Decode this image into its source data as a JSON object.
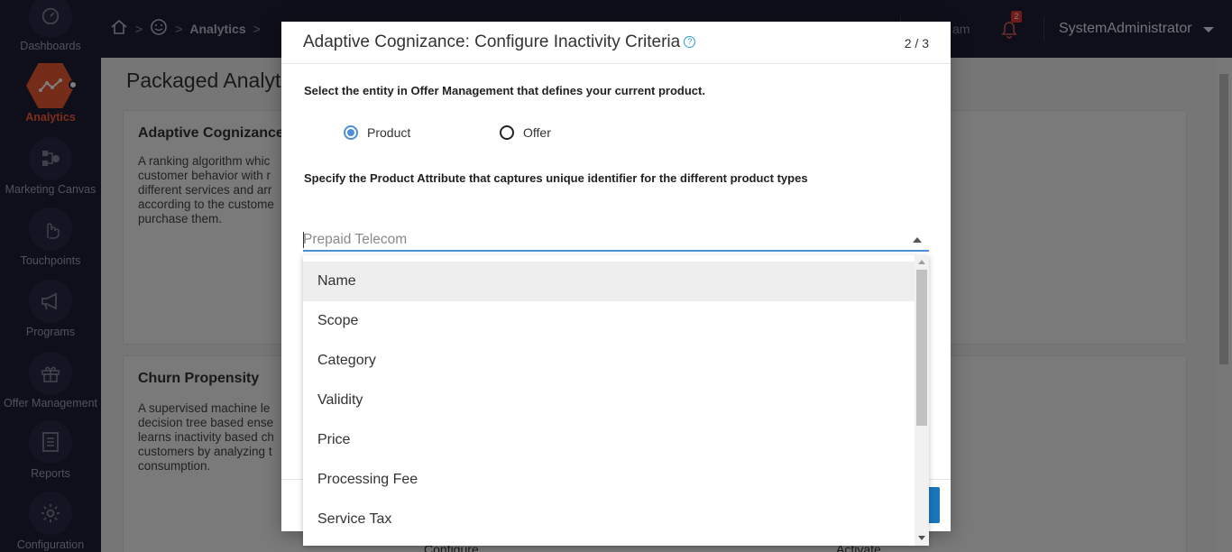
{
  "sidebar": {
    "items": [
      {
        "label": "Dashboards",
        "icon": "dashboard-icon",
        "active": false
      },
      {
        "label": "Analytics",
        "icon": "analytics-icon",
        "active": true
      },
      {
        "label": "Marketing Canvas",
        "icon": "canvas-icon",
        "active": false
      },
      {
        "label": "Touchpoints",
        "icon": "touch-icon",
        "active": false
      },
      {
        "label": "Programs",
        "icon": "megaphone-icon",
        "active": false
      },
      {
        "label": "Offer Management",
        "icon": "gift-icon",
        "active": false
      },
      {
        "label": "Reports",
        "icon": "report-icon",
        "active": false
      },
      {
        "label": "Configuration",
        "icon": "gear-icon",
        "active": false
      }
    ],
    "accent_color": "#ea5a34"
  },
  "topbar": {
    "breadcrumb": [
      "Analytics"
    ],
    "team_text": "am",
    "notification_count": "2",
    "user_name": "SystemAdministrator"
  },
  "page": {
    "title": "Packaged Analyti",
    "cards": [
      {
        "title": "Adaptive Cognizance",
        "desc": "A ranking algorithm whic customer behavior with r different services and arr according to the custome purchase them."
      },
      {
        "title": "Churn Propensity",
        "desc": "A supervised machine le decision tree based ense learns inactivity based ch customers by analyzing t consumption."
      }
    ],
    "card_links": {
      "configure": "Configure",
      "activate": "Activate"
    }
  },
  "modal": {
    "title": "Adaptive Cognizance: Configure Inactivity Criteria",
    "help_glyph": "?",
    "step": "2 / 3",
    "question1": "Select the entity in Offer Management that defines your current product.",
    "radio_options": [
      {
        "label": "Product",
        "selected": true
      },
      {
        "label": "Offer",
        "selected": false
      }
    ],
    "question2": "Specify the Product Attribute that captures unique identifier for the different product types",
    "select_placeholder": "Prepaid Telecom",
    "dropdown_options": [
      "Name",
      "Scope",
      "Category",
      "Validity",
      "Price",
      "Processing Fee",
      "Service Tax"
    ],
    "highlighted_option": "Name",
    "primary_color": "#1b75bb"
  }
}
